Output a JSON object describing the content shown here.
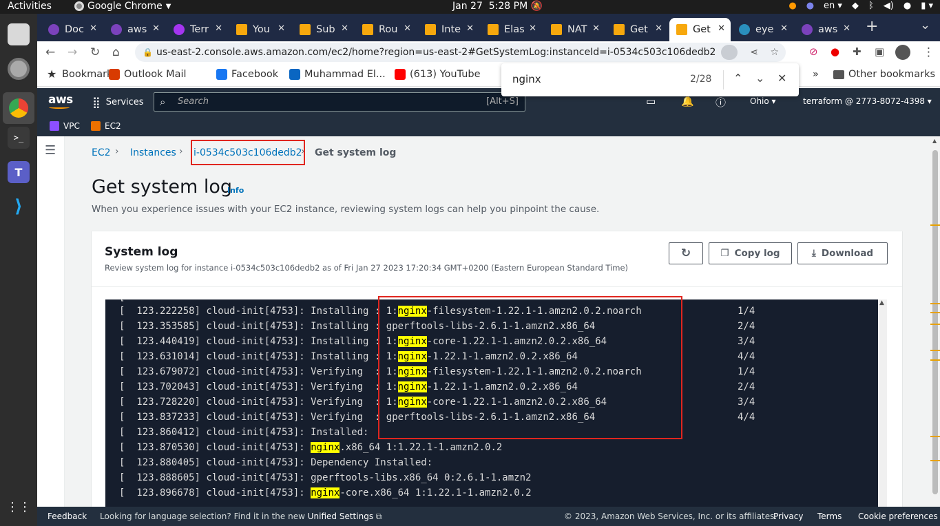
{
  "system": {
    "activities": "Activities",
    "app_name": "Google Chrome",
    "date": "Jan 27",
    "time": "5:28 PM",
    "lang": "en"
  },
  "tabs": [
    {
      "label": "Doc",
      "icon": "terraform-icon",
      "color": "#7b42bc"
    },
    {
      "label": "aws",
      "icon": "terraform-icon",
      "color": "#7b42bc"
    },
    {
      "label": "Terr",
      "icon": "udemy-icon",
      "color": "#a435f0"
    },
    {
      "label": "You",
      "icon": "aws-cube-icon",
      "color": "#f7a80d"
    },
    {
      "label": "Sub",
      "icon": "aws-cube-icon",
      "color": "#f7a80d"
    },
    {
      "label": "Rou",
      "icon": "aws-cube-icon",
      "color": "#f7a80d"
    },
    {
      "label": "Inte",
      "icon": "aws-cube-icon",
      "color": "#f7a80d"
    },
    {
      "label": "Elas",
      "icon": "aws-cube-icon",
      "color": "#f7a80d"
    },
    {
      "label": "NAT",
      "icon": "aws-cube-icon",
      "color": "#f7a80d"
    },
    {
      "label": "Get",
      "icon": "aws-cube-icon",
      "color": "#f7a80d"
    },
    {
      "label": "Get",
      "icon": "aws-cube-icon",
      "color": "#f7a80d",
      "active": true
    },
    {
      "label": "eye",
      "icon": "eye-icon",
      "color": "#2a8fbd"
    },
    {
      "label": "aws",
      "icon": "terraform-icon",
      "color": "#7b42bc"
    }
  ],
  "url": "us-east-2.console.aws.amazon.com/ec2/home?region=us-east-2#GetSystemLog:instanceId=i-0534c503c106dedb2",
  "bookmarks": [
    {
      "label": "Bookmarks",
      "icon": "star-icon"
    },
    {
      "label": "Outlook Mail",
      "icon": "office-icon"
    },
    {
      "label": "Facebook",
      "icon": "facebook-icon"
    },
    {
      "label": "Muhammad El...",
      "icon": "linkedin-icon"
    },
    {
      "label": "(613) YouTube",
      "icon": "youtube-icon"
    }
  ],
  "other_bookmarks": "Other bookmarks",
  "find": {
    "query": "nginx",
    "count": "2/28"
  },
  "aws": {
    "logo": "aws",
    "services": "Services",
    "search_placeholder": "Search",
    "search_shortcut": "[Alt+S]",
    "region": "Ohio",
    "account": "terraform @ 2773-8072-4398"
  },
  "favorites": [
    {
      "label": "VPC",
      "color": "#8c4fff"
    },
    {
      "label": "EC2",
      "color": "#ed7100"
    }
  ],
  "breadcrumb": {
    "ec2": "EC2",
    "instances": "Instances",
    "instance_id": "i-0534c503c106dedb2",
    "current": "Get system log"
  },
  "page": {
    "title": "Get system log",
    "info": "Info",
    "description": "When you experience issues with your EC2 instance, reviewing system logs can help you pinpoint the cause."
  },
  "panel": {
    "title": "System log",
    "subtitle": "Review system log for instance i-0534c503c106dedb2 as of Fri Jan 27 2023 17:20:34 GMT+0200 (Eastern European Standard Time)",
    "copy_label": "Copy log",
    "download_label": "Download"
  },
  "log_lines": [
    {
      "ts": "[  123.222258] cloud-init[4753]: Installing : ",
      "pre": "1:",
      "hl": "nginx",
      "post": "-filesystem-1.22.1-1.amzn2.0.2.noarch",
      "n": "1/4"
    },
    {
      "ts": "[  123.353585] cloud-init[4753]: Installing : ",
      "pre": "gperftools-libs-2.6.1-1.amzn2.x86_64",
      "hl": "",
      "post": "",
      "n": "2/4"
    },
    {
      "ts": "[  123.440419] cloud-init[4753]: Installing : ",
      "pre": "1:",
      "hl": "nginx",
      "post": "-core-1.22.1-1.amzn2.0.2.x86_64",
      "n": "3/4"
    },
    {
      "ts": "[  123.631014] cloud-init[4753]: Installing : ",
      "pre": "1:",
      "hl": "nginx",
      "post": "-1.22.1-1.amzn2.0.2.x86_64",
      "n": "4/4"
    },
    {
      "ts": "[  123.679072] cloud-init[4753]: Verifying  : ",
      "pre": "1:",
      "hl": "nginx",
      "post": "-filesystem-1.22.1-1.amzn2.0.2.noarch",
      "n": "1/4"
    },
    {
      "ts": "[  123.702043] cloud-init[4753]: Verifying  : ",
      "pre": "1:",
      "hl": "nginx",
      "post": "-1.22.1-1.amzn2.0.2.x86_64",
      "n": "2/4"
    },
    {
      "ts": "[  123.728220] cloud-init[4753]: Verifying  : ",
      "pre": "1:",
      "hl": "nginx",
      "post": "-core-1.22.1-1.amzn2.0.2.x86_64",
      "n": "3/4"
    },
    {
      "ts": "[  123.837233] cloud-init[4753]: Verifying  : ",
      "pre": "gperftools-libs-2.6.1-1.amzn2.x86_64",
      "hl": "",
      "post": "",
      "n": "4/4"
    },
    {
      "ts": "[  123.860412] cloud-init[4753]: Installed:",
      "pre": "",
      "hl": "",
      "post": "",
      "n": ""
    },
    {
      "ts": "[  123.870530] cloud-init[4753]: ",
      "pre": "",
      "hl": "nginx",
      "post": ".x86_64 1:1.22.1-1.amzn2.0.2",
      "n": ""
    },
    {
      "ts": "[  123.880405] cloud-init[4753]: Dependency Installed:",
      "pre": "",
      "hl": "",
      "post": "",
      "n": ""
    },
    {
      "ts": "[  123.888605] cloud-init[4753]: gperftools-libs.x86_64 0:2.6.1-1.amzn2",
      "pre": "",
      "hl": "",
      "post": "",
      "n": ""
    },
    {
      "ts": "[  123.896678] cloud-init[4753]: ",
      "pre": "",
      "hl": "nginx",
      "post": "-core.x86_64 1:1.22.1-1.amzn2.0.2",
      "n": ""
    }
  ],
  "footer": {
    "feedback": "Feedback",
    "lang_text": "Looking for language selection? Find it in the new",
    "unified": "Unified Settings",
    "copyright": "© 2023, Amazon Web Services, Inc. or its affiliates.",
    "privacy": "Privacy",
    "terms": "Terms",
    "cookies": "Cookie preferences"
  }
}
